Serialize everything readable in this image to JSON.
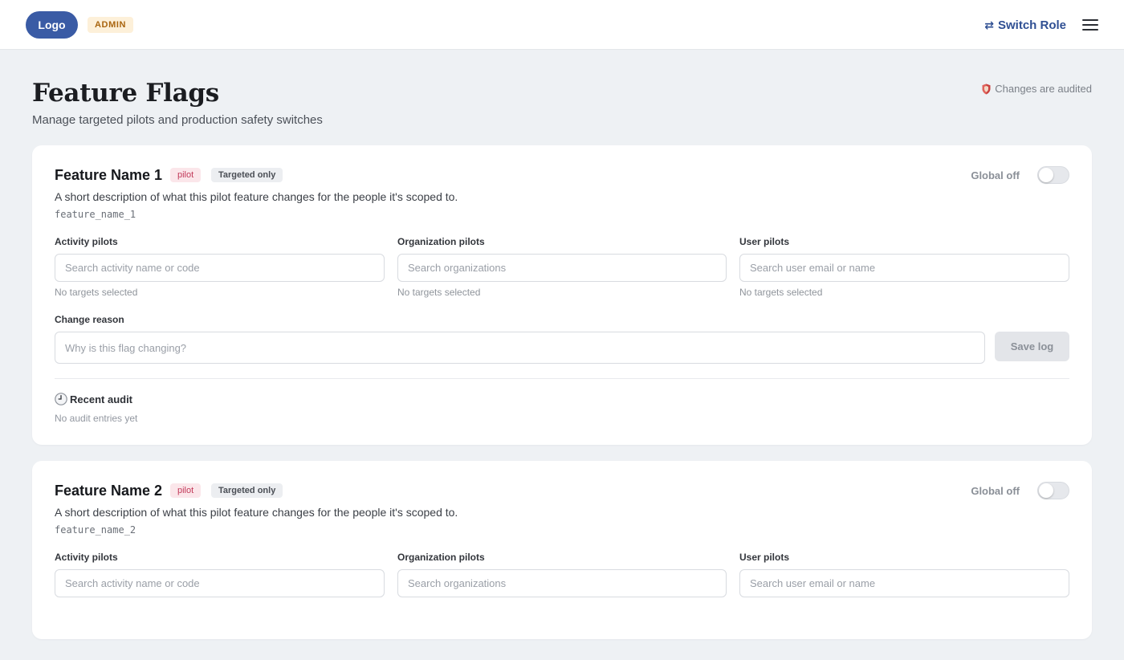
{
  "header": {
    "logo": "Logo",
    "role_badge": "ADMIN",
    "switch_role_icon": "⇄",
    "switch_role_label": "Switch Role",
    "menu_icon": "hamburger-menu-icon"
  },
  "page": {
    "title": "Feature Flags",
    "subtitle": "Manage targeted pilots and production safety switches",
    "audit_notice": "Changes are audited",
    "audit_icon": "shield-icon"
  },
  "labels": {
    "global_toggle": "Global off",
    "activity_pilots": "Activity pilots",
    "organization_pilots": "Organization pilots",
    "user_pilots": "User pilots",
    "no_targets": "No targets selected",
    "change_reason": "Change reason",
    "save_log": "Save log",
    "recent_audit": "Recent audit",
    "no_audit": "No audit entries yet"
  },
  "placeholders": {
    "activity": "Search activity name or code",
    "organization": "Search organizations",
    "user": "Search user email or name",
    "reason": "Why is this flag changing?"
  },
  "features": [
    {
      "name": "Feature Name 1",
      "tag": "pilot",
      "scope": "Targeted only",
      "description": "A short description of what this pilot feature changes for the people it's scoped to.",
      "key": "feature_name_1",
      "global_enabled": false
    },
    {
      "name": "Feature Name 2",
      "tag": "pilot",
      "scope": "Targeted only",
      "description": "A short description of what this pilot feature changes for the people it's scoped to.",
      "key": "feature_name_2",
      "global_enabled": false
    }
  ],
  "colors": {
    "brand": "#3a5ba5",
    "admin_badge_bg": "#fdf0d9",
    "pilot_tag": "#c23a5a",
    "page_bg": "#eef1f4"
  }
}
